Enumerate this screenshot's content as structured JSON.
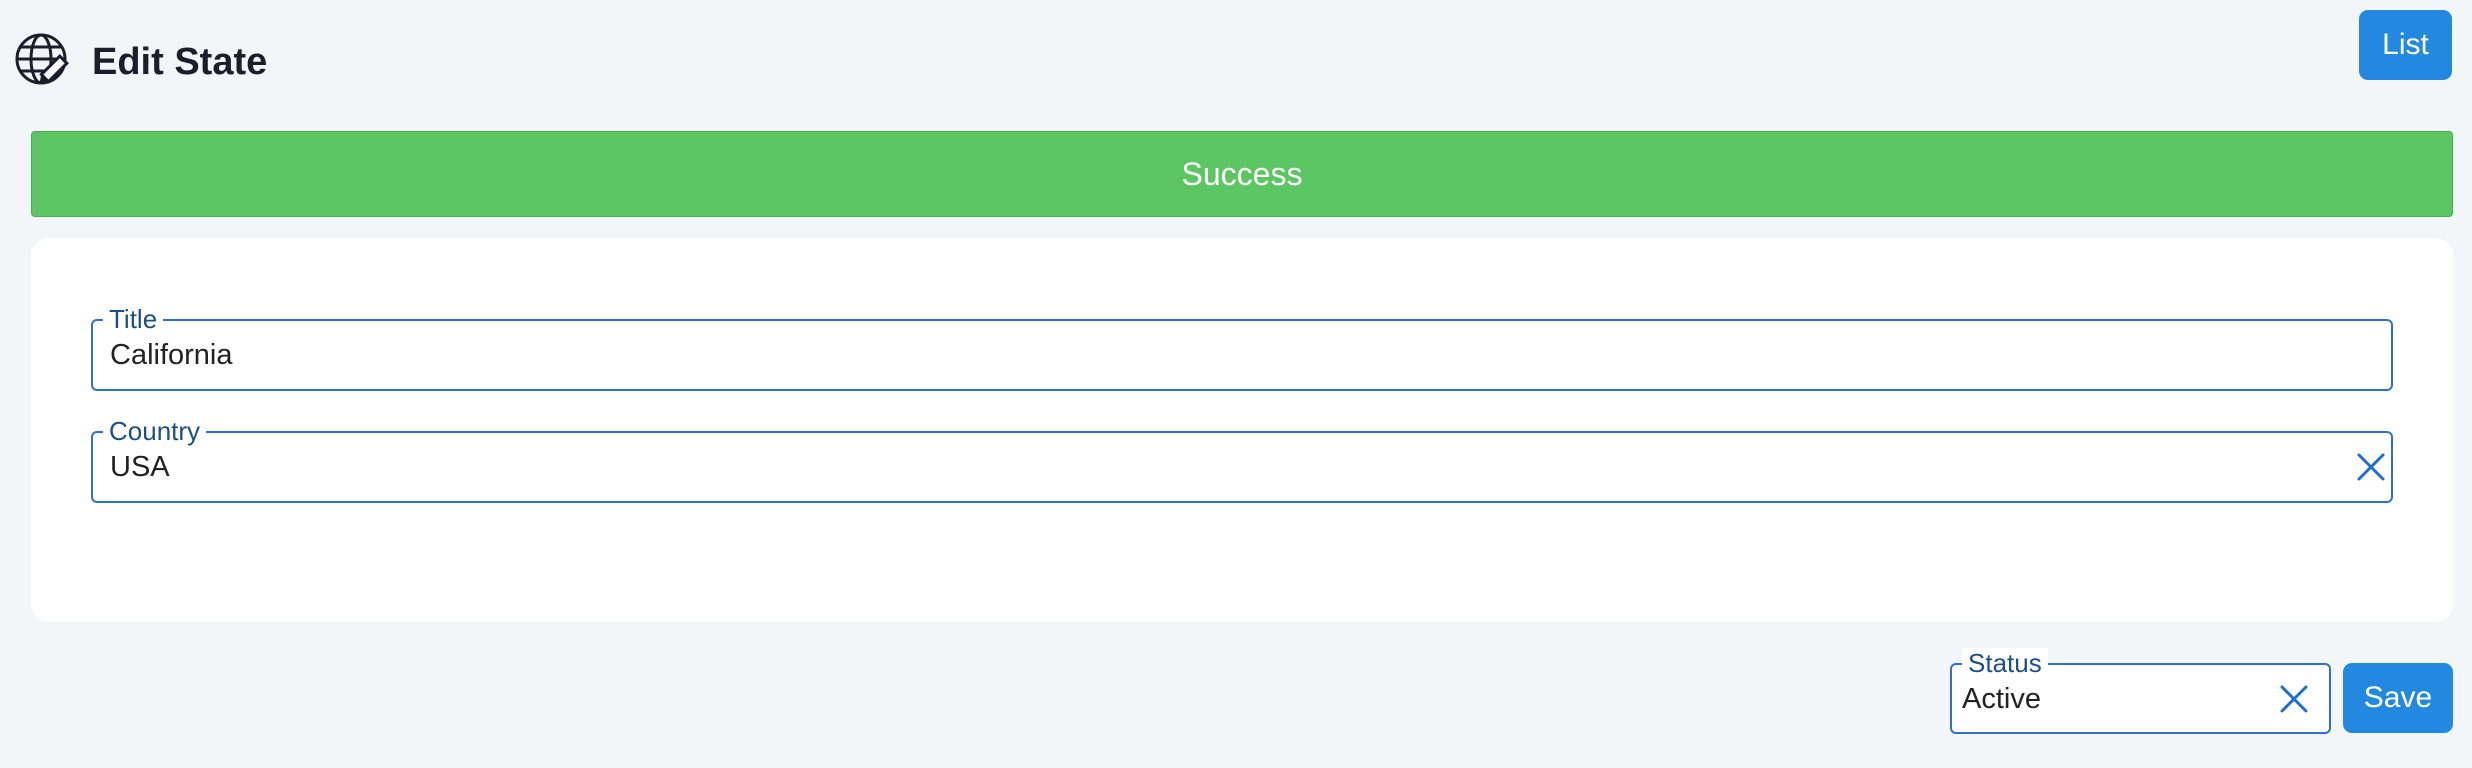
{
  "header": {
    "icon": "globe-edit-icon",
    "title": "Edit State",
    "list_label": "List"
  },
  "alert": {
    "text": "Success",
    "color": "#5cc762"
  },
  "form": {
    "title": {
      "label": "Title",
      "value": "California"
    },
    "country": {
      "label": "Country",
      "value": "USA",
      "clear_icon": "close-icon"
    }
  },
  "footer": {
    "status": {
      "label": "Status",
      "value": "Active",
      "clear_icon": "close-icon"
    },
    "save_label": "Save"
  },
  "colors": {
    "accent": "#2389e0",
    "field_border": "#2f72c5",
    "background": "#f3f6f9"
  }
}
